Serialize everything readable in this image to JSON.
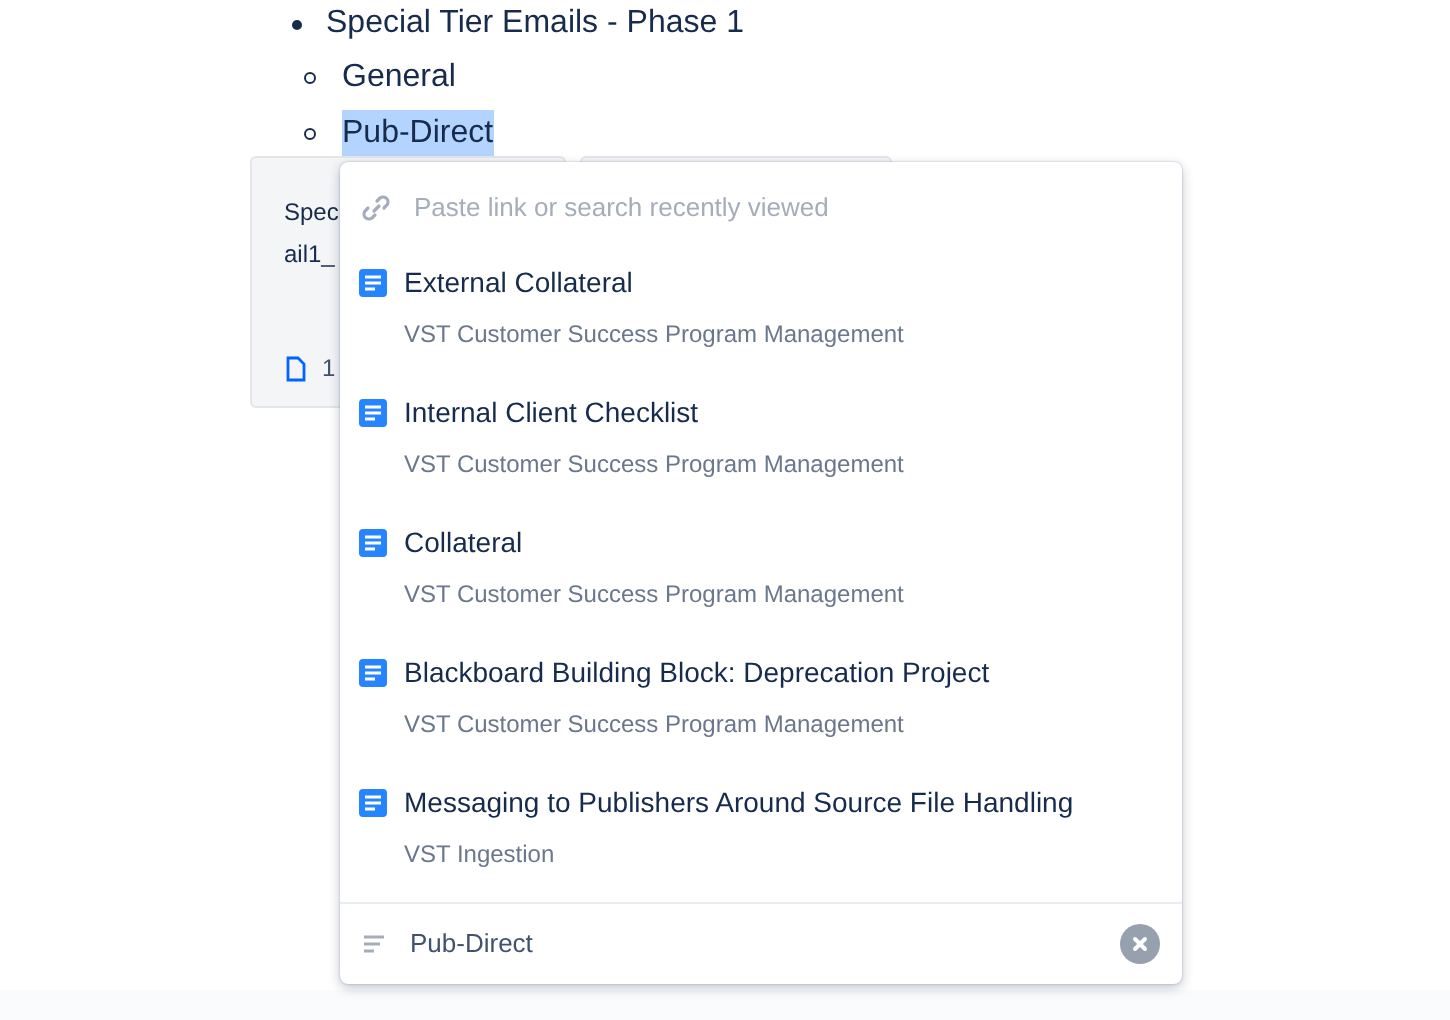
{
  "outline": {
    "text": "Special Tier Emails - Phase 1",
    "children": [
      {
        "text": "General",
        "selected": false
      },
      {
        "text": "Pub-Direct",
        "selected": true
      }
    ]
  },
  "attachment_card": {
    "line_1": "Spec",
    "line_2": "ail1_",
    "size": "1"
  },
  "link_popup": {
    "search": {
      "placeholder": "Paste link or search recently viewed"
    },
    "results": [
      {
        "title": "External Collateral",
        "space": "VST Customer Success Program Management"
      },
      {
        "title": "Internal Client Checklist",
        "space": "VST Customer Success Program Management"
      },
      {
        "title": "Collateral",
        "space": "VST Customer Success Program Management"
      },
      {
        "title": "Blackboard Building Block: Deprecation Project",
        "space": "VST Customer Success Program Management"
      },
      {
        "title": "Messaging to Publishers Around Source File Handling",
        "space": "VST Ingestion"
      }
    ],
    "display_text": "Pub-Direct"
  }
}
